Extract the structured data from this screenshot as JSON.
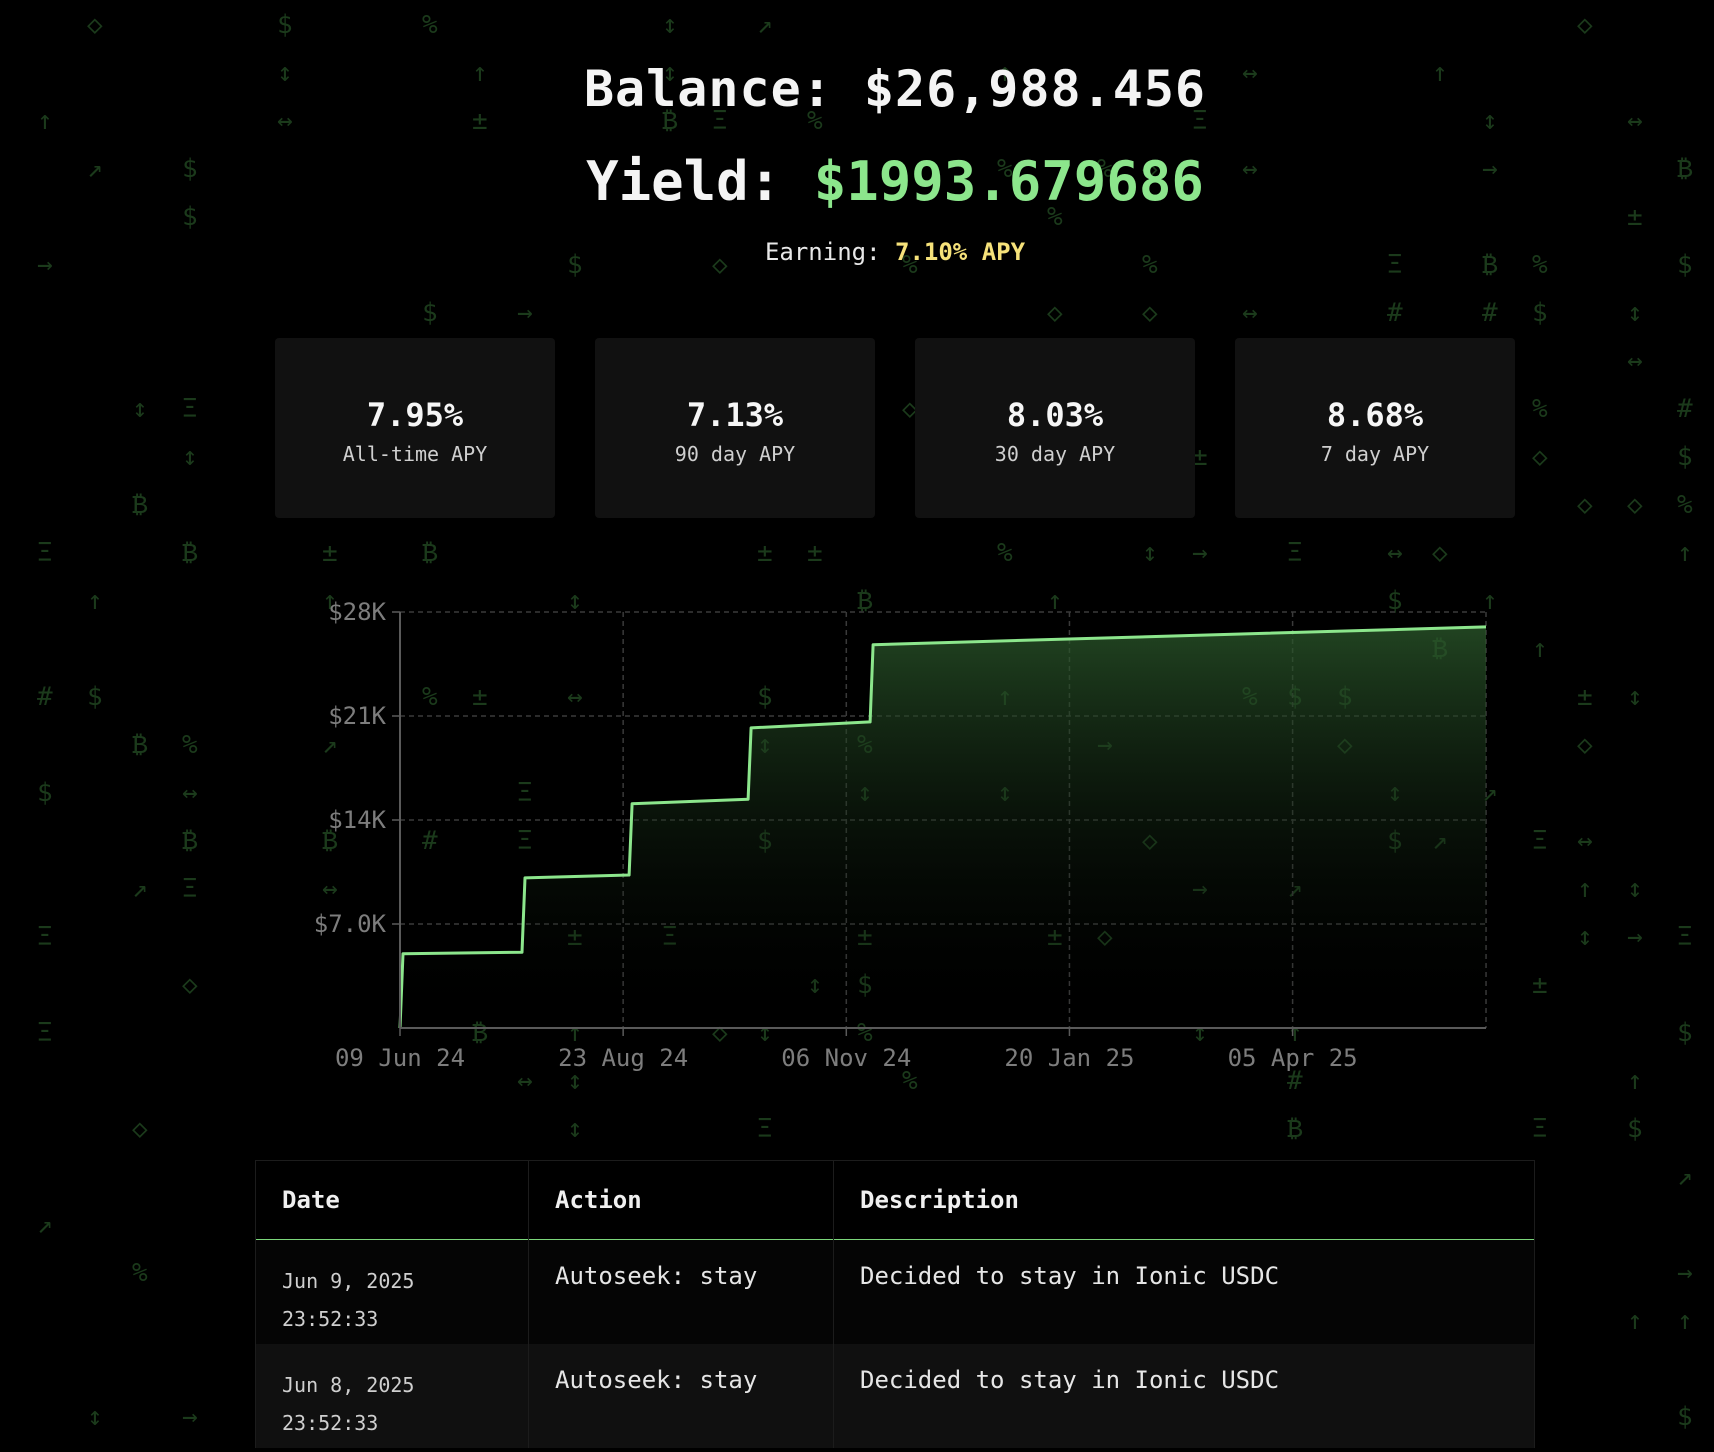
{
  "header": {
    "balance_label": "Balance:",
    "balance_value": "$26,988.456",
    "yield_label": "Yield:",
    "yield_value": "$1993.679686",
    "earning_label": "Earning:",
    "earning_value": "7.10% APY"
  },
  "stats": [
    {
      "value": "7.95%",
      "label": "All-time APY"
    },
    {
      "value": "7.13%",
      "label": "90 day APY"
    },
    {
      "value": "8.03%",
      "label": "30 day APY"
    },
    {
      "value": "8.68%",
      "label": "7 day APY"
    }
  ],
  "colors": {
    "background": "#000000",
    "accent_green": "#8ce68c",
    "apy_yellow": "#f6e27a",
    "card_bg": "#111111",
    "axis_text": "#7d7d7d"
  },
  "chart_data": {
    "type": "line",
    "title": "",
    "xlabel": "",
    "ylabel": "",
    "x_ticks": [
      "09 Jun 24",
      "23 Aug 24",
      "06 Nov 24",
      "20 Jan 25",
      "05 Apr 25"
    ],
    "y_ticks": [
      "$7.0K",
      "$14K",
      "$21K",
      "$28K"
    ],
    "y_tick_values": [
      7000,
      14000,
      21000,
      28000
    ],
    "ylim": [
      0,
      28000
    ],
    "xlim": [
      "2024-06-09",
      "2025-06-09"
    ],
    "area_fill": true,
    "grid": true,
    "series": [
      {
        "x": [
          "2024-06-09",
          "2024-06-10",
          "2024-07-20",
          "2024-07-21",
          "2024-08-25",
          "2024-08-26",
          "2024-10-04",
          "2024-10-05",
          "2024-11-14",
          "2024-11-15",
          "2025-06-09"
        ],
        "values": [
          0,
          5000,
          5100,
          10100,
          10300,
          15100,
          15400,
          20200,
          20600,
          25800,
          27000
        ]
      }
    ]
  },
  "table": {
    "headers": [
      "Date",
      "Action",
      "Description"
    ],
    "rows": [
      {
        "date": "Jun 9, 2025",
        "time": "23:52:33",
        "action": "Autoseek: stay",
        "description": "Decided to stay in Ionic USDC"
      },
      {
        "date": "Jun 8, 2025",
        "time": "23:52:33",
        "action": "Autoseek: stay",
        "description": "Decided to stay in Ionic USDC"
      }
    ]
  }
}
